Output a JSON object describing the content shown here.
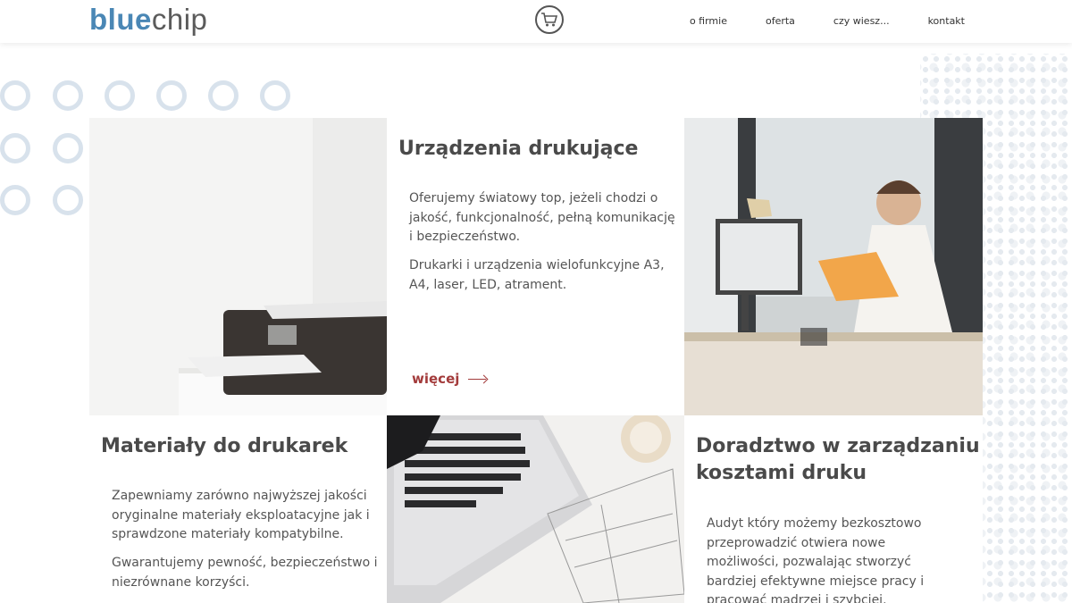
{
  "header": {
    "logo_part1": "blue",
    "logo_part2": "chip",
    "cart_icon": "shopping-cart-icon",
    "nav": [
      "o firmie",
      "oferta",
      "czy wiesz...",
      "kontakt"
    ]
  },
  "tiles": {
    "printers": {
      "title": "Urządzenia drukujące",
      "p1": "Oferujemy światowy top, jeżeli chodzi o jakość, funkcjonalność, pełną komunikację i bezpieczeństwo.",
      "p2": "Drukarki i urządzenia wielofunkcyjne A3, A4, laser, LED, atrament.",
      "more": "więcej"
    },
    "supplies": {
      "title": "Materiały do drukarek",
      "p1": "Zapewniamy zarówno najwyższej jakości oryginalne materiały eksploatacyjne jak i sprawdzone materiały kompatybilne.",
      "p2": "Gwarantujemy pewność, bezpieczeństwo i niezrównane korzyści."
    },
    "consulting": {
      "title": "Doradztwo w zarządzaniu kosztami druku",
      "p1": "Audyt który możemy bezkosztowo przeprowadzić otwiera nowe możliwości, pozwalając stworzyć bardziej efektywne miejsce pracy i pracować mądrzej i szybciej."
    }
  },
  "colors": {
    "brand_blue": "#4a87b5",
    "accent_red": "#a33b3b",
    "circle": "#d8e2ec"
  }
}
